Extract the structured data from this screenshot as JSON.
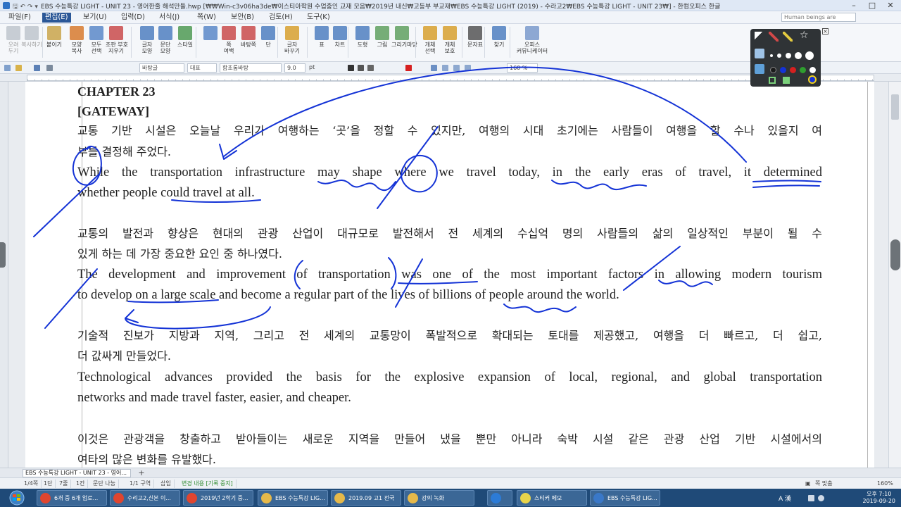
{
  "window": {
    "title": "EBS 수능특강 LIGHT - UNIT 23 - 영어한줄 해석만들.hwp [₩₩Win-c3v06ha3de₩이스티아학원 수업중인 교재 모음₩2019년 내신₩고등부 부교재₩EBS 수능특강 LIGHT (2019) - 수라고2₩EBS 수능특강 LIGHT - UNIT 23₩] - 한컴오피스 한글",
    "quick_access": "🖫 ↶ ↷ ▾",
    "buttons": [
      "–",
      "□",
      "✕"
    ]
  },
  "menu": {
    "items": [
      "파일(F)",
      "편집(E)",
      "보기(U)",
      "입력(D)",
      "서식(J)",
      "쪽(W)",
      "보안(B)",
      "검토(H)",
      "도구(K)"
    ],
    "active_index": 1,
    "search_placeholder": "Human beings are"
  },
  "ribbon": {
    "buttons": [
      {
        "label": "오려\n두기",
        "icon": "scissors-icon",
        "color": "#9aa3ad",
        "disabled": true
      },
      {
        "label": "복사하기",
        "icon": "copy-icon",
        "color": "#9aa3ad",
        "disabled": true
      },
      {
        "label": "붙이기",
        "icon": "paste-icon",
        "color": "#c9a44a"
      },
      {
        "label": "모양\n복사",
        "icon": "format-painter-icon",
        "color": "#d77a2e"
      },
      {
        "label": "모두\n선택",
        "icon": "select-all-icon",
        "color": "#5a88c8"
      },
      {
        "label": "조판 부호\n지우기",
        "icon": "clear-marks-icon",
        "color": "#c94b4b"
      },
      {
        "label": "글자\n모양",
        "icon": "char-shape-icon",
        "color": "#4f7fc0"
      },
      {
        "label": "문단\n모양",
        "icon": "para-shape-icon",
        "color": "#4f7fc0"
      },
      {
        "label": "스타일",
        "icon": "style-icon",
        "color": "#4f9a54"
      },
      {
        "label": "",
        "icon": "page-icon",
        "color": "#5a88c8"
      },
      {
        "label": "쪽\n여백",
        "icon": "margin-icon",
        "color": "#c94b4b"
      },
      {
        "label": "바탕쪽",
        "icon": "master-page-icon",
        "color": "#c94b4b"
      },
      {
        "label": "단",
        "icon": "columns-icon",
        "color": "#4f7fc0"
      },
      {
        "label": "글자\n바꾸기",
        "icon": "replace-icon",
        "color": "#d7a02e"
      },
      {
        "label": "표",
        "icon": "table-icon",
        "color": "#4f7fc0"
      },
      {
        "label": "차트",
        "icon": "chart-icon",
        "color": "#4f7fc0"
      },
      {
        "label": "도형",
        "icon": "shape-icon",
        "color": "#4f7fc0"
      },
      {
        "label": "그림",
        "icon": "picture-icon",
        "color": "#5fa05f"
      },
      {
        "label": "그리기마당",
        "icon": "clipart-icon",
        "color": "#5fa05f"
      },
      {
        "label": "개체\n선택",
        "icon": "object-select-icon",
        "color": "#d7a02e"
      },
      {
        "label": "개체\n보호",
        "icon": "object-lock-icon",
        "color": "#d7a02e"
      },
      {
        "label": "문자표",
        "icon": "symbol-icon",
        "color": "#555555"
      },
      {
        "label": "찾기",
        "icon": "binoculars-icon",
        "color": "#4f7fc0"
      },
      {
        "label": "오피스\n커뮤니케이터",
        "icon": "communicator-icon",
        "color": "#7a9acb"
      }
    ]
  },
  "format_bar": {
    "style": "바탕글",
    "font_lang": "대표",
    "font": "함초롬바탕",
    "size": "9.0",
    "size_unit": "pt",
    "zoom": "160 %"
  },
  "document": {
    "lines": [
      {
        "text": "CHAPTER 23",
        "kind": "chap"
      },
      {
        "text": "[GATEWAY]",
        "kind": "chap"
      },
      {
        "text": "교통 기반 시설은 오늘날 우리가 여행하는 ‘곳’을 정할 수 있지만, 여행의 시대 초기에는 사람들이 여행을 할 수나 있을지 여",
        "kind": "ko"
      },
      {
        "text": "부를 결정해 주었다.",
        "kind": "ko last"
      },
      {
        "text": "While the transportation infrastructure may shape where we travel today, in the early eras of travel, it determined",
        "kind": "en"
      },
      {
        "text": "whether people could travel at all.",
        "kind": "en last"
      },
      {
        "text": "",
        "kind": "en last"
      },
      {
        "text": "교통의 발전과 향상은 현대의 관광 산업이 대규모로 발전해서 전 세계의 수십억 명의 사람들의 삶의 일상적인 부분이 될 수",
        "kind": "ko"
      },
      {
        "text": "있게 하는 데 가장 중요한 요인 중 하나였다.",
        "kind": "ko last"
      },
      {
        "text": "The development and improvement of transportation was one of the most important factors in allowing modern tourism",
        "kind": "en"
      },
      {
        "text": "to develop on a large scale and become a regular part of the lives of billions of people around the world.",
        "kind": "en last"
      },
      {
        "text": "",
        "kind": "en last"
      },
      {
        "text": "기술적 진보가 지방과 지역, 그리고 전 세계의 교통망이 폭발적으로 확대되는 토대를 제공했고, 여행을 더 빠르고, 더 쉽고,",
        "kind": "ko"
      },
      {
        "text": "더 값싸게 만들었다.",
        "kind": "ko last"
      },
      {
        "text": "Technological advances provided the basis for the explosive expansion of local, regional, and global transportation",
        "kind": "en"
      },
      {
        "text": "networks and made travel faster, easier, and cheaper.",
        "kind": "en last"
      },
      {
        "text": "",
        "kind": "en last"
      },
      {
        "text": "이것은 관광객을 창출하고 받아들이는 새로운 지역을 만들어 냈을 뿐만 아니라 숙박 시설 같은 관광 산업 기반 시설에서의",
        "kind": "ko"
      },
      {
        "text": "여타의 많은 변화를 유발했다.",
        "kind": "ko last"
      }
    ],
    "ink_color": "#1433d6"
  },
  "pen_palette": {
    "close_label": "×",
    "colors": [
      "#1a1a1a",
      "#1433d6",
      "#d62020",
      "#2f9e2f",
      "#ffffff",
      "#f2d21b"
    ]
  },
  "tabs": {
    "document_tab": "EBS 수능특강 LIGHT - UNIT 23 - 영어...",
    "add": "+"
  },
  "status": {
    "items": [
      "1/4쪽",
      "1단",
      "7줄",
      "1칸",
      "문단 나눔",
      "1/1 구역",
      "삽입",
      "변경 내용 [기록 중지]"
    ],
    "zoom": "쪽 맞춤",
    "zoom_value": "160%"
  },
  "taskbar": {
    "items": [
      {
        "label": "6개 중 6개 업로...",
        "icon": "chrome-icon",
        "color": "#e0452f"
      },
      {
        "label": "수리고2,신본 이...",
        "icon": "chrome-icon",
        "color": "#e0452f"
      },
      {
        "label": "2019년 2학기 중...",
        "icon": "chrome-icon",
        "color": "#e0452f"
      },
      {
        "label": "EBS 수능특강 LIG...",
        "icon": "folder-icon",
        "color": "#e6b94a"
      },
      {
        "label": "2019.09 고1 전국",
        "icon": "folder-icon",
        "color": "#e6b94a"
      },
      {
        "label": "강의 녹화",
        "icon": "folder-icon",
        "color": "#e6b94a"
      },
      {
        "label": "",
        "icon": "ie-icon",
        "color": "#2c7bd6"
      },
      {
        "label": "스티커 메모",
        "icon": "sticky-icon",
        "color": "#e8d44a"
      },
      {
        "label": "EBS 수능특강 LIG...",
        "icon": "hwp-icon",
        "color": "#3a78c8"
      }
    ],
    "ime": "A 漢",
    "time": "오후 7:10",
    "date": "2019-09-20"
  }
}
